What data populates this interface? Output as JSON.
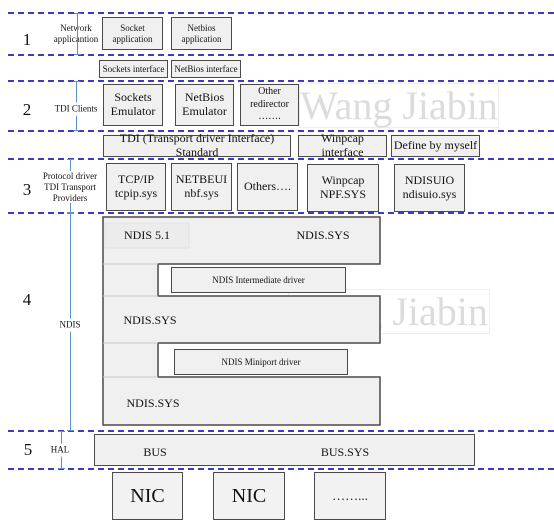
{
  "layers": {
    "l1": {
      "number": "1",
      "label": "Network\napplicantion"
    },
    "l2": {
      "number": "2",
      "label": "TDI Clients"
    },
    "l3": {
      "number": "3",
      "label": "Protocol driver\nTDI Transport\nProviders"
    },
    "l4": {
      "number": "4",
      "label": "NDIS"
    },
    "l5": {
      "number": "5",
      "label": "HAL"
    }
  },
  "applications": {
    "socket": "Socket\napplication",
    "netbios": "Netbios\napplication"
  },
  "interfaces": {
    "sockets": "Sockets interface",
    "netbios": "NetBios interface"
  },
  "tdi_clients": {
    "sockets": "Sockets\nEmulator",
    "netbios": "NetBios\nEmulator",
    "other": "Other\nredirector\n……."
  },
  "watermark": "Wang Jiabin",
  "standards": {
    "tdi": "TDI (Transport driver Interface) Standard",
    "winpcap": "Winpcap interface",
    "custom": "Define by myself"
  },
  "protocols": {
    "tcpip": "TCP/IP\ntcpip.sys",
    "netbeui": "NETBEUI\nnbf.sys",
    "others": "Others….",
    "winpcap": "Winpcap\nNPF.SYS",
    "ndisuio": "NDISUIO\nndisuio.sys"
  },
  "ndis": {
    "version": "NDIS 5.1",
    "top_sys": "NDIS.SYS",
    "intermediate": "NDIS Intermediate driver",
    "middle_sys": "NDIS.SYS",
    "miniport": "NDIS Miniport driver",
    "bottom_sys": "NDIS.SYS"
  },
  "hal": {
    "bus": "BUS",
    "bus_sys": "BUS.SYS"
  },
  "nics": [
    "NIC",
    "NIC",
    "……..."
  ],
  "colors": {
    "dash": "#3b3bc4",
    "box_fill": "#f0f0f0",
    "arrow": "#5b8fd0",
    "watermark": "#dcdcdc"
  }
}
